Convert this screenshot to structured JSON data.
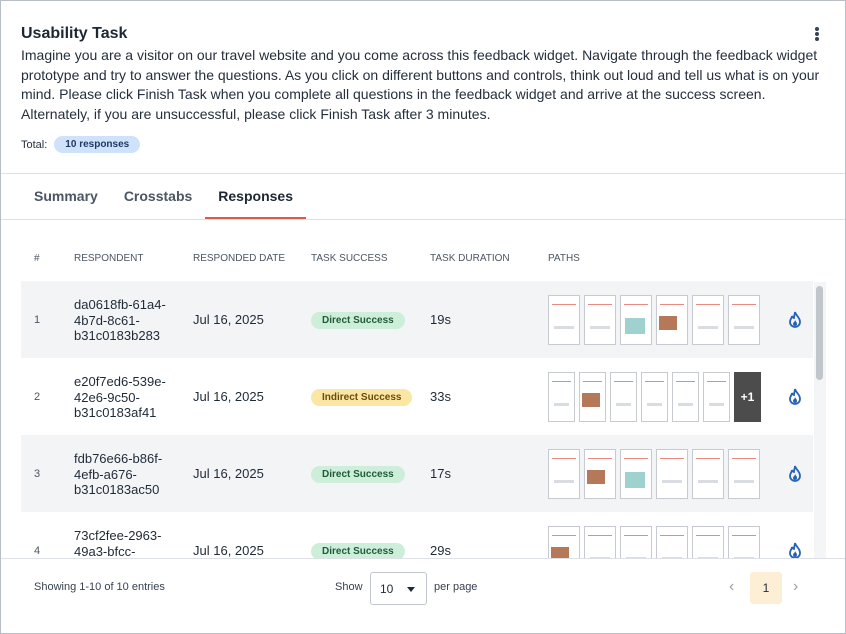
{
  "header": {
    "title": "Usability Task",
    "description": "Imagine you are a visitor on our travel website and you come across this feedback widget. Navigate through the feedback widget prototype and try to answer the questions. As you click on different buttons and controls, think out loud and tell us what is on your mind. Please click Finish Task when you complete all questions in the feedback widget and arrive at the success screen. Alternately, if you are unsuccessful, please click Finish Task after 3 minutes.",
    "total_label": "Total:",
    "total_badge": "10 responses",
    "menu_icon": "kebab-menu-icon"
  },
  "tabs": [
    {
      "label": "Summary",
      "active": false
    },
    {
      "label": "Crosstabs",
      "active": false
    },
    {
      "label": "Responses",
      "active": true
    }
  ],
  "table": {
    "columns": [
      "#",
      "RESPONDENT",
      "RESPONDED DATE",
      "TASK SUCCESS",
      "TASK DURATION",
      "PATHS"
    ],
    "rows": [
      {
        "num": "1",
        "respondent": "da0618fb-61a4-4b7d-8c61-b31c0183b283",
        "date": "Jul 16, 2025",
        "status": "Direct Success",
        "duration": "19s"
      },
      {
        "num": "2",
        "respondent": "e20f7ed6-539e-42e6-9c50-b31c0183af41",
        "date": "Jul 16, 2025",
        "status": "Indirect Success",
        "duration": "33s",
        "more": "+1"
      },
      {
        "num": "3",
        "respondent": "fdb76e66-b86f-4efb-a676-b31c0183ac50",
        "date": "Jul 16, 2025",
        "status": "Direct Success",
        "duration": "17s"
      },
      {
        "num": "4",
        "respondent": "73cf2fee-2963-49a3-bfcc-",
        "date": "Jul 16, 2025",
        "status": "Direct Success",
        "duration": "29s"
      }
    ],
    "heatmap_icon": "flame-icon"
  },
  "footer": {
    "showing": "Showing 1-10 of 10 entries",
    "show_label": "Show",
    "page_size": "10",
    "per_page": "per page",
    "current_page": "1",
    "prev": "‹",
    "next": "›"
  },
  "colors": {
    "accent": "#e2574c",
    "direct_badge": "#cdeed9",
    "indirect_badge": "#fbe6a4",
    "total_badge": "#cfe2fb",
    "icon_blue": "#2563b8"
  }
}
